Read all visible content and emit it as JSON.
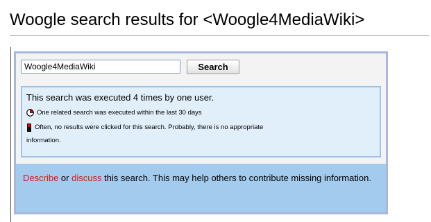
{
  "page": {
    "heading": "Woogle search results for <Woogle4MediaWiki>"
  },
  "search": {
    "value": "Woogle4MediaWiki",
    "button_label": "Search"
  },
  "stats": {
    "summary": "This search was executed 4 times by one user.",
    "related": "One related search was executed within the last 30 days",
    "clicks_line1": "Often, no results were clicked for this search. Probably, there is no appropriate",
    "clicks_line2": "information."
  },
  "discuss": {
    "describe_link": "Describe",
    "or_text": " or ",
    "discuss_link": "discuss",
    "rest_text": " this search. This may help others to contribute missing information."
  },
  "icons": {
    "related_icon": "pie-chart-icon",
    "clicks_icon": "traffic-light-icon"
  },
  "colors": {
    "panel_border": "#aab7dd",
    "stats_bg": "#e1effa",
    "stats_border": "#9cc3e6",
    "discuss_bg": "#a3cbee",
    "link": "#d11c1c"
  }
}
